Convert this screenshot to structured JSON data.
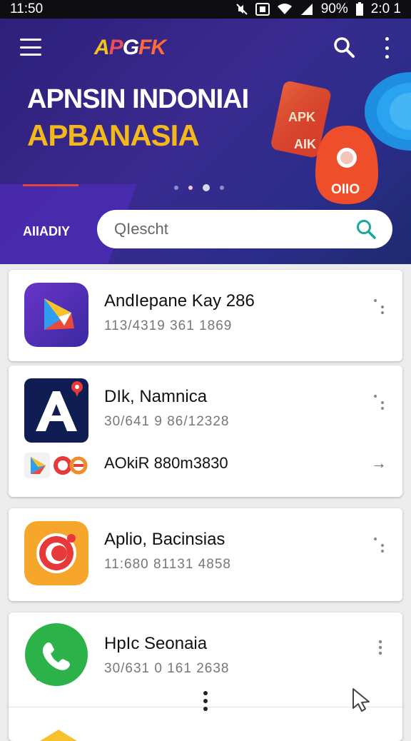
{
  "status_bar": {
    "time": "11:50",
    "battery": "90%",
    "clock_right": "2:0 1"
  },
  "hero": {
    "logo": {
      "a": "A",
      "p": "P",
      "g": "G",
      "f": "FK"
    },
    "headline_line1": "APNSIN INDONIAI",
    "headline_line2": "APBANASIA",
    "badge_top": "APK",
    "badge_mid": "AIK",
    "badge_bottom": "OIIO",
    "carousel": {
      "count": 4,
      "active_index": 2
    },
    "region_label": "AIIADIY",
    "search": {
      "placeholder": "QIescht"
    }
  },
  "apps": [
    {
      "title": "AndIepane Kay 286",
      "sub": "113/4319 361 1869"
    },
    {
      "title": "DIk, Namnica",
      "sub": "30/641 9 86/12328",
      "extra_title": "AOkiR 880m3830"
    },
    {
      "title": "Aplio, Bacinsias",
      "sub": "11:680 81131 4858"
    },
    {
      "title": "HpIc Seonaia",
      "sub": "30/631 0 161 2638"
    }
  ],
  "colors": {
    "hero_bg": "#3a2a8f",
    "accent_yellow": "#f2b81c",
    "accent_red": "#e0463c",
    "search_teal": "#1ba8a0"
  }
}
